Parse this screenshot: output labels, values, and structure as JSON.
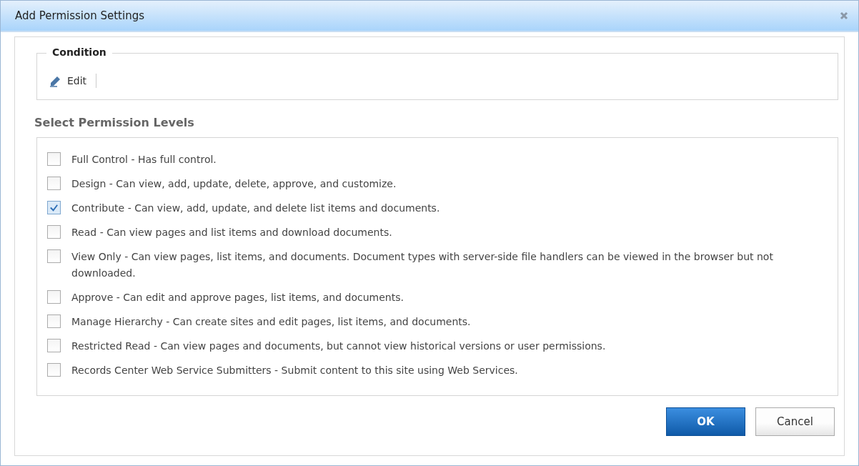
{
  "window": {
    "title": "Add Permission Settings"
  },
  "condition": {
    "legend": "Condition",
    "edit_label": "Edit"
  },
  "permission_levels": {
    "heading": "Select Permission Levels",
    "items": [
      {
        "label": "Full Control - Has full control.",
        "checked": false
      },
      {
        "label": "Design - Can view, add, update, delete, approve, and customize.",
        "checked": false
      },
      {
        "label": "Contribute - Can view, add, update, and delete list items and documents.",
        "checked": true
      },
      {
        "label": "Read - Can view pages and list items and download documents.",
        "checked": false
      },
      {
        "label": "View Only - Can view pages, list items, and documents. Document types with server-side file handlers can be viewed in the browser but not downloaded.",
        "checked": false
      },
      {
        "label": "Approve - Can edit and approve pages, list items, and documents.",
        "checked": false
      },
      {
        "label": "Manage Hierarchy - Can create sites and edit pages, list items, and documents.",
        "checked": false
      },
      {
        "label": "Restricted Read - Can view pages and documents, but cannot view historical versions or user permissions.",
        "checked": false
      },
      {
        "label": "Records Center Web Service Submitters - Submit content to this site using Web Services.",
        "checked": false
      }
    ]
  },
  "buttons": [
    {
      "label": "OK",
      "kind": "primary"
    },
    {
      "label": "Cancel",
      "kind": "secondary"
    }
  ]
}
